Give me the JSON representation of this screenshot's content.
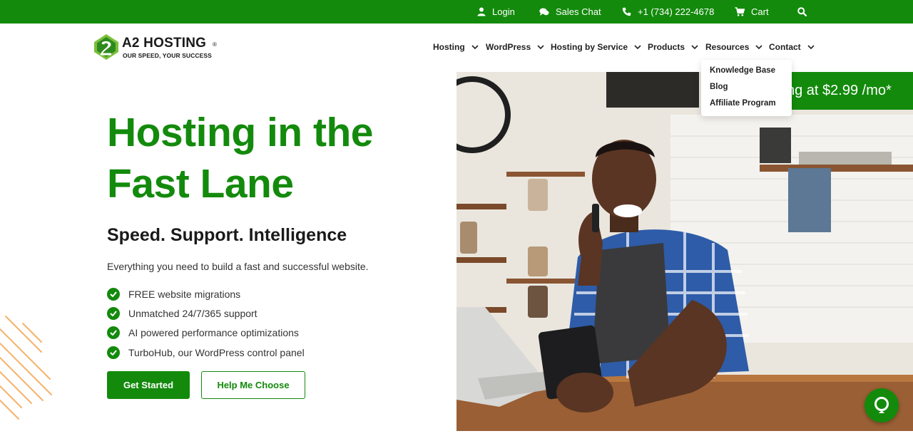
{
  "topbar": {
    "login": "Login",
    "sales_chat": "Sales Chat",
    "phone": "+1 (734) 222-4678",
    "cart": "Cart",
    "icons": [
      "user-icon",
      "chat-icon",
      "phone-icon",
      "cart-icon",
      "search-icon"
    ]
  },
  "logo": {
    "brand": "A2 HOSTING",
    "registered": "®",
    "tagline": "OUR SPEED, YOUR SUCCESS"
  },
  "nav": {
    "items": [
      {
        "label": "Hosting"
      },
      {
        "label": "WordPress"
      },
      {
        "label": "Hosting by Service"
      },
      {
        "label": "Products"
      },
      {
        "label": "Resources"
      },
      {
        "label": "Contact"
      }
    ]
  },
  "dropdown": {
    "items": [
      {
        "label": "Knowledge Base"
      },
      {
        "label": "Blog"
      },
      {
        "label": "Affiliate Program"
      }
    ]
  },
  "promo": {
    "text": "ng at $2.99 /mo*"
  },
  "hero": {
    "title_line1": "Hosting in the",
    "title_line2": "Fast Lane",
    "subtitle": "Speed. Support. Intelligence",
    "description": "Everything you need to build a fast and successful website.",
    "features": [
      "FREE website migrations",
      "Unmatched 24/7/365 support",
      "AI powered performance optimizations",
      "TurboHub, our WordPress control panel"
    ],
    "cta_primary": "Get Started",
    "cta_secondary": "Help Me Choose"
  },
  "colors": {
    "brand_green": "#138a0c",
    "text_dark": "#1a1a1a"
  }
}
